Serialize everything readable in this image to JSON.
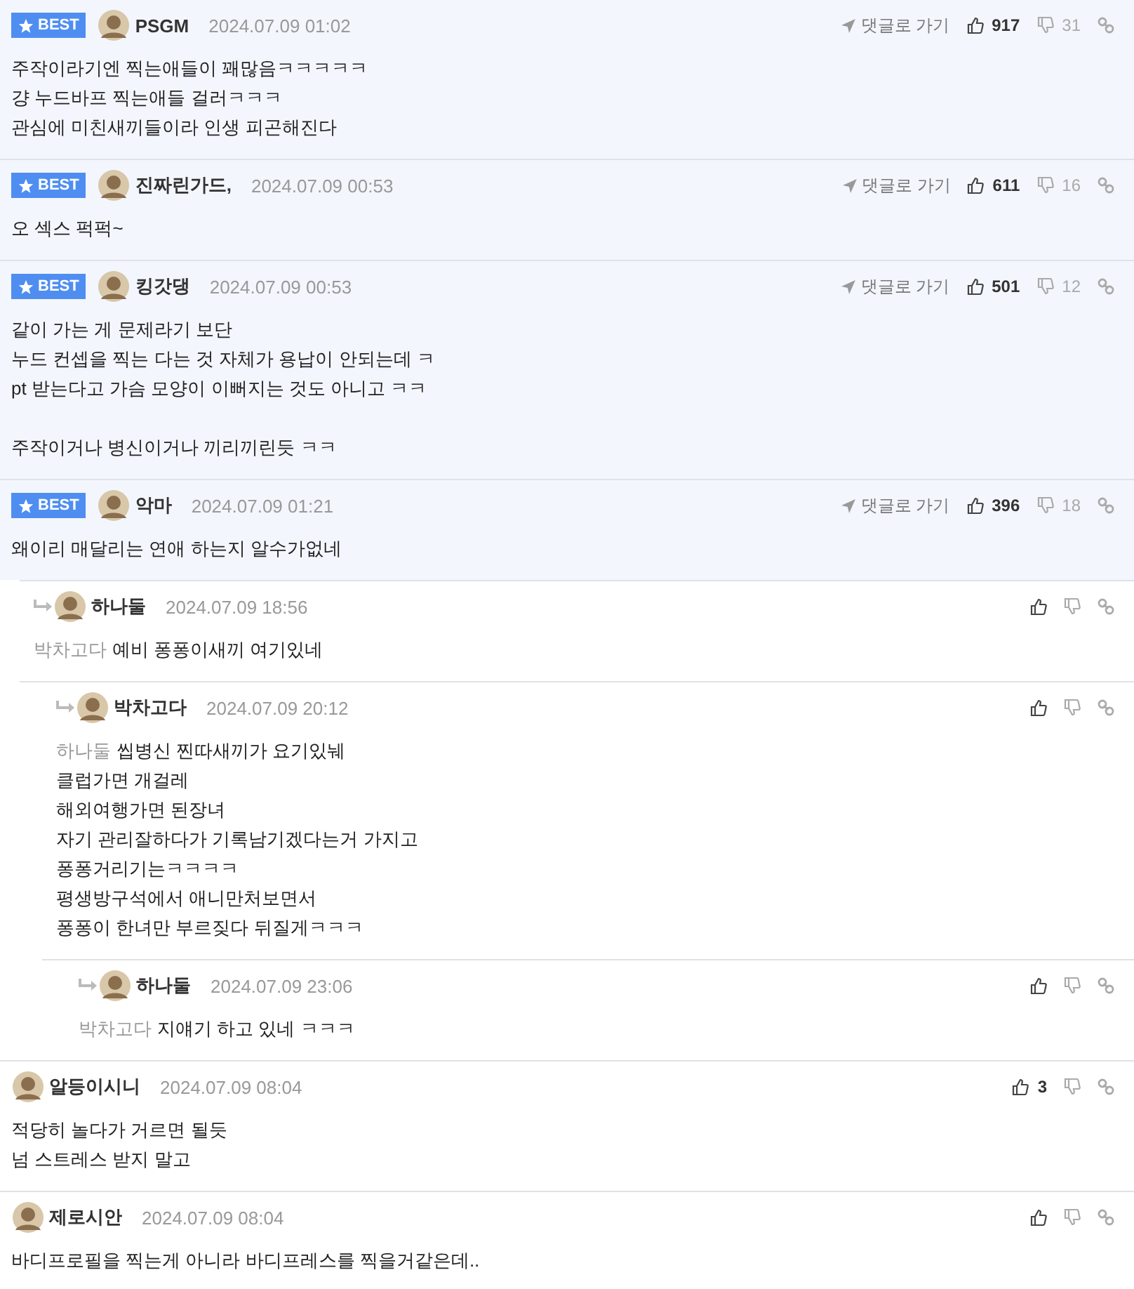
{
  "comments": [
    {
      "best": true,
      "badge": "BEST",
      "author": "PSGM",
      "date": "2024.07.09 01:02",
      "goto": "댓글로 가기",
      "likes": "917",
      "dislikes": "31",
      "lines": [
        "주작이라기엔 찍는애들이 꽤많음ㅋㅋㅋㅋㅋ",
        "걍 누드바프 찍는애들 걸러ㅋㅋㅋ",
        "관심에 미친새끼들이라 인생 피곤해진다"
      ]
    },
    {
      "best": true,
      "badge": "BEST",
      "author": "진짜린가드,",
      "date": "2024.07.09 00:53",
      "goto": "댓글로 가기",
      "likes": "611",
      "dislikes": "16",
      "lines": [
        "오 섹스 퍽퍽~"
      ]
    },
    {
      "best": true,
      "badge": "BEST",
      "author": "킹갓댕",
      "date": "2024.07.09 00:53",
      "goto": "댓글로 가기",
      "likes": "501",
      "dislikes": "12",
      "lines": [
        "같이 가는 게 문제라기 보단",
        "누드 컨셉을 찍는 다는 것 자체가 용납이 안되는데 ㅋ",
        "pt 받는다고 가슴 모양이 이뻐지는 것도 아니고 ㅋㅋ"
      ],
      "second_paragraph": [
        "주작이거나 병신이거나 끼리끼린듯 ㅋㅋ"
      ]
    },
    {
      "best": true,
      "badge": "BEST",
      "author": "악마",
      "date": "2024.07.09 01:21",
      "goto": "댓글로 가기",
      "likes": "396",
      "dislikes": "18",
      "lines": [
        "왜이리 매달리는 연애 하는지 알수가없네"
      ],
      "children": [
        {
          "best": false,
          "author": "하나둘",
          "date": "2024.07.09 18:56",
          "mention": "박차고다",
          "lines": [
            "예비 퐁퐁이새끼 여기있네"
          ],
          "children": [
            {
              "best": false,
              "author": "박차고다",
              "date": "2024.07.09 20:12",
              "mention": "하나둘",
              "lines": [
                "씹병신 찐따새끼가 요기있눼",
                "클럽가면 개걸레",
                "해외여행가면 된장녀",
                "자기 관리잘하다가 기록남기겠다는거 가지고",
                "퐁퐁거리기는ㅋㅋㅋㅋ",
                "평생방구석에서 애니만처보면서",
                "퐁퐁이 한녀만 부르짖다 뒤질게ㅋㅋㅋ"
              ],
              "children": [
                {
                  "best": false,
                  "author": "하나둘",
                  "date": "2024.07.09 23:06",
                  "mention": "박차고다",
                  "lines": [
                    "지얘기 하고 있네 ㅋㅋㅋ"
                  ]
                }
              ]
            }
          ]
        }
      ]
    },
    {
      "best": false,
      "author": "알등이시니",
      "date": "2024.07.09 08:04",
      "likes": "3",
      "lines": [
        "적당히 놀다가 거르면 될듯",
        "넘 스트레스 받지 말고"
      ]
    },
    {
      "best": false,
      "author": "제로시안",
      "date": "2024.07.09 08:04",
      "lines": [
        "바디프로필을 찍는게 아니라 바디프레스를 찍을거같은데.."
      ]
    }
  ]
}
